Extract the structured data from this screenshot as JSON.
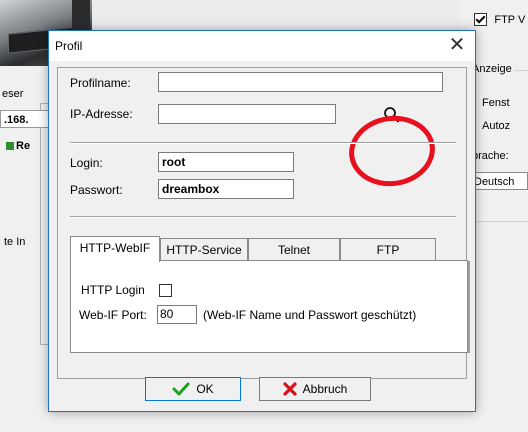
{
  "background": {
    "left_labels": [
      "eser",
      ".168.",
      "Re",
      "te In"
    ],
    "right": {
      "ftp_checkbox_label": "FTP V",
      "group_label": "Anzeige",
      "option1_label": "Fenst",
      "option2_label": "Autoz",
      "language_label": "prache:",
      "language_value": "Deutsch"
    }
  },
  "dialog": {
    "title": "Profil",
    "close_glyph": "✕",
    "fields": {
      "profilname_label": "Profilname:",
      "profilname_value": "",
      "ip_label": "IP-Adresse:",
      "ip_value": "",
      "login_label": "Login:",
      "login_value": "root",
      "passwort_label": "Passwort:",
      "passwort_value": "dreambox"
    },
    "search_icon": "search-icon",
    "tabs": [
      {
        "label": "HTTP-WebIF",
        "active": true
      },
      {
        "label": "HTTP-Service",
        "active": false
      },
      {
        "label": "Telnet",
        "active": false
      },
      {
        "label": "FTP",
        "active": false
      }
    ],
    "webif": {
      "http_login_label": "HTTP Login",
      "http_login_checked": false,
      "port_label": "Web-IF Port:",
      "port_value": "80",
      "port_note": "(Web-IF Name und Passwort geschützt)"
    },
    "buttons": {
      "ok_label": "OK",
      "cancel_label": "Abbruch"
    },
    "colors": {
      "ok_icon": "#1aa31a",
      "cancel_icon": "#d8101a",
      "annotation": "#e8101d"
    }
  }
}
